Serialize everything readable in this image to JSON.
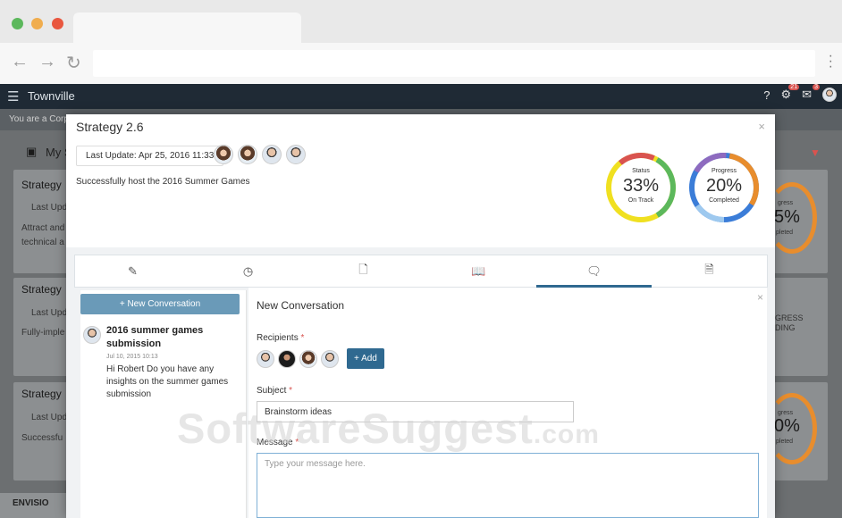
{
  "app": {
    "title": "Townville",
    "badge_alerts": "21",
    "badge_messages": "3",
    "subbar_text": "You are a Corp"
  },
  "background": {
    "my_label": "My S",
    "cards": [
      {
        "title": "Strategy",
        "last_update": "Last Upda",
        "text_lines": [
          "Attract and",
          "technical a"
        ]
      },
      {
        "title": "Strategy",
        "last_update": "Last Upda",
        "text_lines": [
          "Fully-imple"
        ]
      },
      {
        "title": "Strategy",
        "last_update": "Last Upda",
        "text_lines": [
          "Successfu"
        ]
      }
    ],
    "right_cards": [
      {
        "label": "gress",
        "value": "5%",
        "sub": "pleted"
      },
      {
        "label": "GRESS",
        "sub": "DING"
      },
      {
        "label": "gress",
        "value": "0%",
        "sub": "pleted"
      }
    ],
    "footer_logo": "ENVISIO"
  },
  "modal": {
    "title": "Strategy 2.6",
    "close": "×",
    "last_update": "Last Update: Apr 25, 2016 11:33",
    "goal": "Successfully host the 2016 Summer Games",
    "status": {
      "label": "Status",
      "value": "33%",
      "desc": "On Track",
      "percent": 33
    },
    "progress": {
      "label": "Progress",
      "value": "20%",
      "desc": "Completed",
      "percent": 20
    },
    "tabs": [
      {
        "icon": "pencil-icon",
        "glyph": "✎"
      },
      {
        "icon": "clock-icon",
        "glyph": "◷"
      },
      {
        "icon": "file-icon",
        "glyph": "🗋"
      },
      {
        "icon": "book-icon",
        "glyph": "📖"
      },
      {
        "icon": "comments-icon",
        "glyph": "🗨",
        "active": true
      },
      {
        "icon": "document-icon",
        "glyph": "🗎"
      }
    ],
    "new_conversation_button": "+ New Conversation",
    "conversation": {
      "title": "2016 summer games submission",
      "date": "Jul 10, 2015 10:13",
      "body": "Hi Robert Do you have any insights on the summer games submission"
    },
    "form": {
      "title": "New Conversation",
      "close": "×",
      "recipients_label": "Recipients",
      "add_button": "+ Add",
      "subject_label": "Subject",
      "subject_value": "Brainstorm ideas",
      "message_label": "Message",
      "message_placeholder": "Type your message here.",
      "required_mark": "*"
    }
  },
  "watermark": {
    "main": "SoftwareSuggest",
    "suffix": ".com"
  },
  "colors": {
    "accent": "#2f6990",
    "status_green": "#5cb85c",
    "status_yellow": "#f0e020",
    "status_red": "#d9534f",
    "progress_orange": "#e88d2d",
    "progress_blue": "#3b7dd8",
    "progress_purple": "#8e6bbf"
  }
}
